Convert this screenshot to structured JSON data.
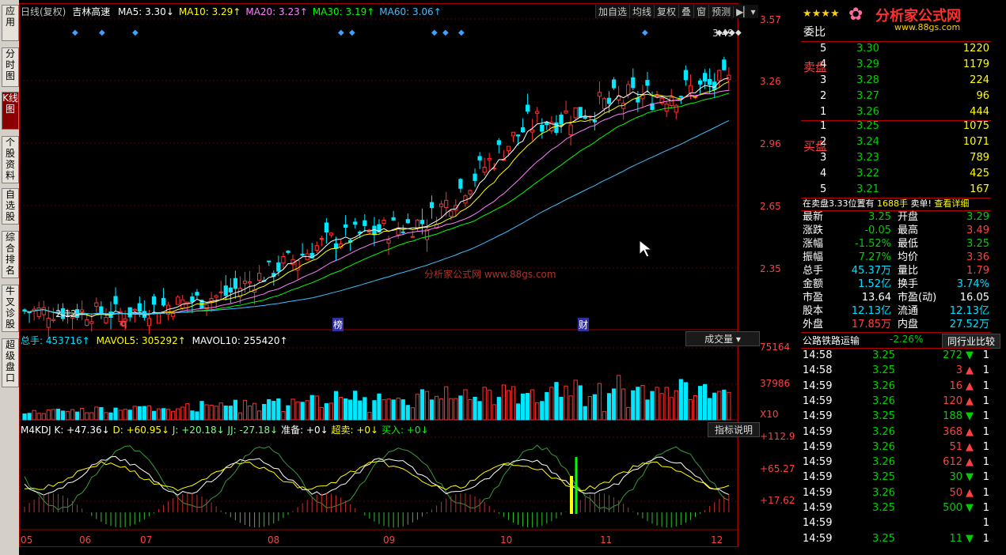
{
  "left_tabs": [
    "应用",
    "分时图",
    "K线图",
    "个股资料",
    "自选股",
    "综合排名",
    "牛叉诊股",
    "超级盘口"
  ],
  "chart": {
    "title": "日线(复权)",
    "stock": "吉林高速",
    "ma": [
      {
        "label": "MA5: 3.30↓",
        "color": "#ffffff"
      },
      {
        "label": "MA10: 3.29↑",
        "color": "#ffff00"
      },
      {
        "label": "MA20: 3.23↑",
        "color": "#ff80ff"
      },
      {
        "label": "MA30: 3.19↑",
        "color": "#00ff00"
      },
      {
        "label": "MA60: 3.06↑",
        "color": "#40c0ff"
      }
    ],
    "toolbar": [
      "加自选",
      "均线",
      "复权",
      "叠",
      "窗",
      "预测"
    ],
    "price_axis": [
      "3.57",
      "3.26",
      "2.96",
      "2.65",
      "2.35"
    ],
    "high_label": "3.49",
    "low_label": "2.12",
    "markers": [
      "q",
      "榜",
      "财"
    ],
    "volume": {
      "total": "总手: 453716↑",
      "mavol5": "MAVOL5: 305292↑",
      "mavol10": "MAVOL10: 255420↑",
      "button": "成交量",
      "axis": [
        "75164",
        "37986",
        "X10"
      ]
    },
    "kdj": {
      "k": "M4KDJ K: +47.36↓",
      "d": "D: +60.95↓",
      "j": "J: +20.18↓",
      "jj": "JJ: -27.18↓",
      "zb": "准备: +0↓",
      "cm": "超卖: +0↓",
      "mr": "买入: +0↓",
      "button": "指标说明",
      "axis": [
        "+112.9",
        "+65.27",
        "+17.62"
      ]
    },
    "months": [
      "05",
      "06",
      "07",
      "08",
      "09",
      "10",
      "11",
      "12"
    ],
    "watermark": "分析家公式网 www.88gs.com"
  },
  "chart_data": {
    "type": "candlestick",
    "x": [
      "05",
      "06",
      "07",
      "08",
      "09",
      "10",
      "11",
      "12"
    ],
    "close": [
      2.14,
      2.13,
      2.22,
      2.48,
      2.58,
      3.05,
      3.18,
      3.25
    ],
    "ylim": [
      2.12,
      3.57
    ]
  },
  "logo": {
    "text": "分析家公式网",
    "url": "www.88gs.com"
  },
  "quote": {
    "title": "委比",
    "sell_label": "卖盘",
    "buy_label": "买盘",
    "sell": [
      {
        "n": "5",
        "p": "3.30",
        "v": "1220"
      },
      {
        "n": "4",
        "p": "3.29",
        "v": "1179"
      },
      {
        "n": "3",
        "p": "3.28",
        "v": "224"
      },
      {
        "n": "2",
        "p": "3.27",
        "v": "96"
      },
      {
        "n": "1",
        "p": "3.26",
        "v": "444"
      }
    ],
    "buy": [
      {
        "n": "1",
        "p": "3.25",
        "v": "1075"
      },
      {
        "n": "2",
        "p": "3.24",
        "v": "1071"
      },
      {
        "n": "3",
        "p": "3.23",
        "v": "789"
      },
      {
        "n": "4",
        "p": "3.22",
        "v": "425"
      },
      {
        "n": "5",
        "p": "3.21",
        "v": "167"
      }
    ],
    "notice": "在卖盘3.33位置有",
    "notice_vol": "1688手",
    "notice_tail": "卖单!",
    "notice_link": "查看详细",
    "stats": [
      {
        "l1": "最新",
        "v1": "3.25",
        "c1": "green",
        "l2": "开盘",
        "v2": "3.29",
        "c2": "green"
      },
      {
        "l1": "涨跌",
        "v1": "-0.05",
        "c1": "green",
        "l2": "最高",
        "v2": "3.49",
        "c2": "red"
      },
      {
        "l1": "涨幅",
        "v1": "-1.52%",
        "c1": "green",
        "l2": "最低",
        "v2": "3.25",
        "c2": "green"
      },
      {
        "l1": "振幅",
        "v1": "7.27%",
        "c1": "green",
        "l2": "均价",
        "v2": "3.36",
        "c2": "red"
      },
      {
        "l1": "总手",
        "v1": "45.37万",
        "c1": "cyan",
        "l2": "量比",
        "v2": "1.79",
        "c2": "red"
      },
      {
        "l1": "金额",
        "v1": "1.52亿",
        "c1": "cyan",
        "l2": "换手",
        "v2": "3.74%",
        "c2": "cyan"
      },
      {
        "l1": "市盈",
        "v1": "13.64",
        "c1": "white",
        "l2": "市盈(动)",
        "v2": "16.05",
        "c2": "white"
      },
      {
        "l1": "股本",
        "v1": "12.13亿",
        "c1": "cyan",
        "l2": "流通",
        "v2": "12.13亿",
        "c2": "cyan"
      },
      {
        "l1": "外盘",
        "v1": "17.85万",
        "c1": "red",
        "l2": "内盘",
        "v2": "27.52万",
        "c2": "cyan"
      }
    ],
    "industry": "公路铁路运输",
    "industry_chg": "-2.26%",
    "industry_btn": "同行业比较",
    "ticks": [
      {
        "t": "14:58",
        "p": "3.25",
        "v": "272",
        "dir": "down",
        "pc": "green"
      },
      {
        "t": "14:58",
        "p": "3.25",
        "v": "3",
        "dir": "up",
        "pc": "green"
      },
      {
        "t": "14:59",
        "p": "3.26",
        "v": "16",
        "dir": "up",
        "pc": "green"
      },
      {
        "t": "14:59",
        "p": "3.26",
        "v": "120",
        "dir": "up",
        "pc": "green"
      },
      {
        "t": "14:59",
        "p": "3.25",
        "v": "188",
        "dir": "down",
        "pc": "green"
      },
      {
        "t": "14:59",
        "p": "3.26",
        "v": "368",
        "dir": "up",
        "pc": "green"
      },
      {
        "t": "14:59",
        "p": "3.26",
        "v": "51",
        "dir": "up",
        "pc": "green"
      },
      {
        "t": "14:59",
        "p": "3.26",
        "v": "612",
        "dir": "up",
        "pc": "green"
      },
      {
        "t": "14:59",
        "p": "3.25",
        "v": "30",
        "dir": "down",
        "pc": "green"
      },
      {
        "t": "14:59",
        "p": "3.26",
        "v": "50",
        "dir": "up",
        "pc": "green"
      },
      {
        "t": "14:59",
        "p": "3.25",
        "v": "500",
        "dir": "down",
        "pc": "green"
      },
      {
        "t": "14:59",
        "p": "",
        "v": "",
        "dir": "",
        "pc": "green"
      },
      {
        "t": "14:59",
        "p": "3.25",
        "v": "11",
        "dir": "down",
        "pc": "green"
      }
    ]
  }
}
